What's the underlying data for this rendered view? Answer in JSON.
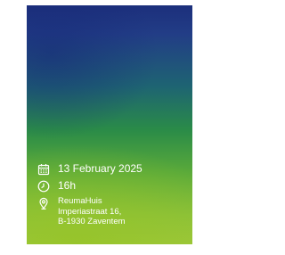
{
  "event": {
    "date": "13 February 2025",
    "time": "16h",
    "location": {
      "name": "ReumaHuis",
      "street": "Imperiastraat 16,",
      "city": "B-1930 Zaventem"
    }
  },
  "icons": {
    "date": "calendar-icon",
    "time": "clock-icon",
    "location": "location-pin-icon"
  },
  "colors": {
    "gradient_top": "#1c2f7c",
    "gradient_bottom": "#9ec83c",
    "text": "#ffffff"
  }
}
